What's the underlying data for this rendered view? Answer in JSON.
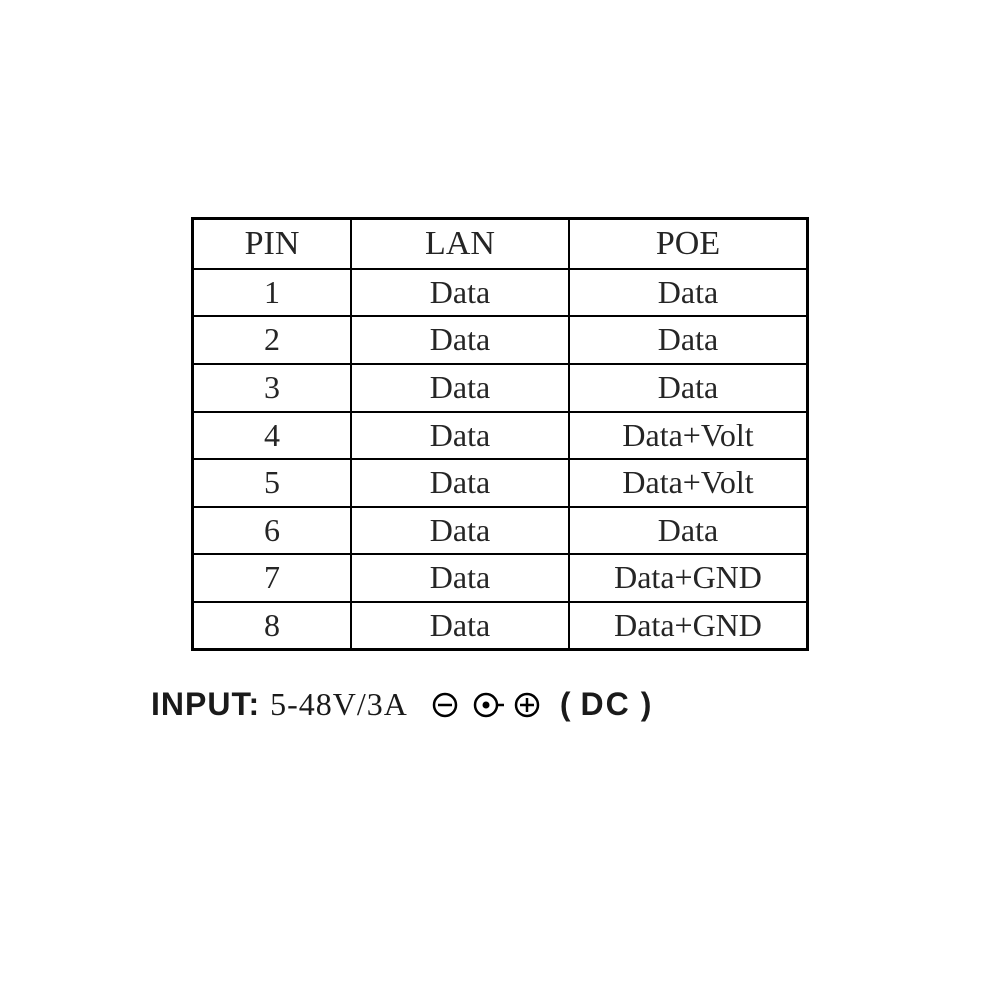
{
  "table": {
    "headers": {
      "pin": "PIN",
      "lan": "LAN",
      "poe": "POE"
    },
    "rows": [
      {
        "pin": "1",
        "lan": "Data",
        "poe": "Data"
      },
      {
        "pin": "2",
        "lan": "Data",
        "poe": "Data"
      },
      {
        "pin": "3",
        "lan": "Data",
        "poe": "Data"
      },
      {
        "pin": "4",
        "lan": "Data",
        "poe": "Data+Volt"
      },
      {
        "pin": "5",
        "lan": "Data",
        "poe": "Data+Volt"
      },
      {
        "pin": "6",
        "lan": "Data",
        "poe": "Data"
      },
      {
        "pin": "7",
        "lan": "Data",
        "poe": "Data+GND"
      },
      {
        "pin": "8",
        "lan": "Data",
        "poe": "Data+GND"
      }
    ]
  },
  "input": {
    "label": "INPUT:",
    "value": "5-48V/3A",
    "dc_open": "(",
    "dc": "DC",
    "dc_close": ")"
  }
}
